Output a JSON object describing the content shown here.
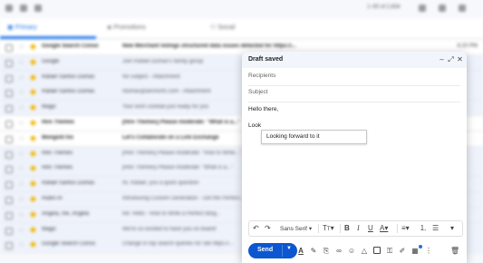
{
  "background": {
    "topbar_text": "1–50 of 2,834",
    "tabs": [
      {
        "label": "Primary",
        "active": true
      },
      {
        "label": "Promotions",
        "active": false
      },
      {
        "label": "Social",
        "active": false
      }
    ],
    "rows": [
      {
        "sender": "Google Search Conso",
        "subject": "New Merchant listings structured data issues detected for https://...",
        "date": "6:20 PM",
        "unread": true
      },
      {
        "sender": "Google",
        "subject": "Join Rafael Dumas's family group",
        "date": "",
        "unread": false
      },
      {
        "sender": "Rafael Santos Dumas",
        "subject": "No subject - Attachment",
        "date": "",
        "unread": false
      },
      {
        "sender": "Rafael Santos Dumas",
        "subject": "rdumas@anchortc.com - Attachment",
        "date": "",
        "unread": false
      },
      {
        "sender": "Magic",
        "subject": "Your wish cocktail just ready for you",
        "date": "",
        "unread": false
      },
      {
        "sender": "Hire Themes",
        "subject": "[Hire Themes] Please moderate: \"What is a...\"",
        "date": "",
        "unread": true
      },
      {
        "sender": "Mongolit Inc",
        "subject": "Let's Collaborate on a Link Exchange",
        "date": "",
        "unread": true
      },
      {
        "sender": "Hire Themes",
        "subject": "[Hire Themes] Please moderate: \"How to Write...\"",
        "date": "",
        "unread": false
      },
      {
        "sender": "Hire Themes",
        "subject": "[Hire Themes] Please moderate: \"What is a...\"",
        "date": "",
        "unread": false
      },
      {
        "sender": "Rafael Santos Dumas",
        "subject": "Hi, Rafael, you a quick question",
        "date": "",
        "unread": false
      },
      {
        "sender": "Hubin AI",
        "subject": "Introducing Custom Generation - Get the Perfect...",
        "date": "",
        "unread": false
      },
      {
        "sender": "Angela, me, Angela",
        "subject": "Re: Hello - How to Write a Perfect Blog...",
        "date": "",
        "unread": false
      },
      {
        "sender": "Magic",
        "subject": "We're so excited to have you on board!",
        "date": "",
        "unread": false
      },
      {
        "sender": "Google Search Conso",
        "subject": "Change in top search queries for site https://...",
        "date": "",
        "unread": false
      }
    ]
  },
  "compose": {
    "title": "Draft saved",
    "recipients_placeholder": "Recipients",
    "subject_placeholder": "Subject",
    "recipients_value": "",
    "subject_value": "",
    "body_lines": [
      "Hello there,",
      "Look"
    ],
    "suggestion": "Looking forward to it",
    "font": "Sans Serif",
    "send_label": "Send",
    "colors": {
      "send": "#0b57d0",
      "header": "#f2f6fc"
    }
  }
}
